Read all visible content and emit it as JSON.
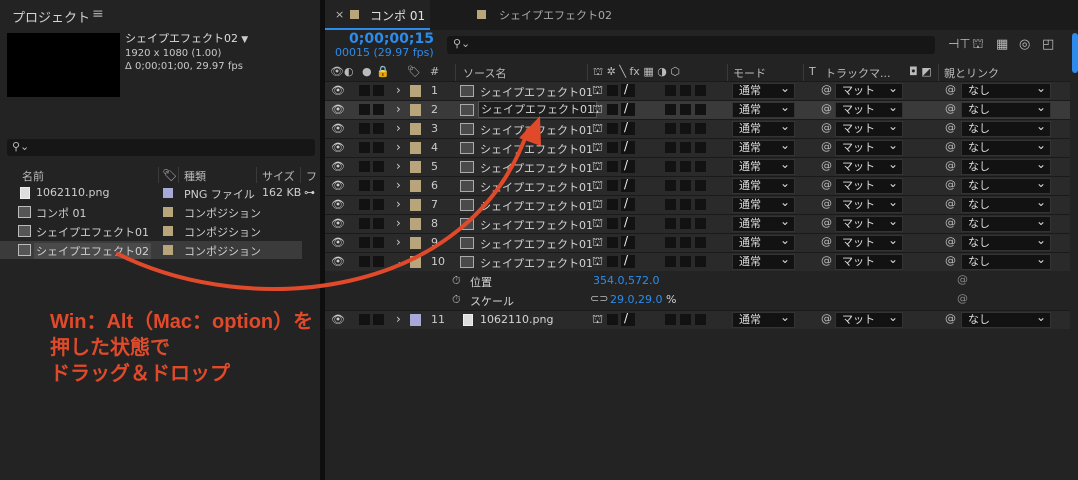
{
  "project": {
    "title": "プロジェクト",
    "menu_icon": "≡",
    "selected_name": "シェイプエフェクト02",
    "selected_dims": "1920 x 1080 (1.00)",
    "selected_duration": "Δ 0;00;01;00, 29.97 fps",
    "search_icon": "search-icon",
    "columns": {
      "name": "名前",
      "type": "種類",
      "size": "サイズ",
      "extra": "フ"
    },
    "items": [
      {
        "name": "1062110.png",
        "type": "PNG ファイル",
        "size": "162 KB",
        "label_color": "#a7aad6",
        "icon": "file-icon"
      },
      {
        "name": "コンポ 01",
        "type": "コンポジション",
        "size": "",
        "label_color": "#b9a57c",
        "icon": "composition-icon"
      },
      {
        "name": "シェイプエフェクト01",
        "type": "コンポジション",
        "size": "",
        "label_color": "#b9a57c",
        "icon": "composition-icon"
      },
      {
        "name": "シェイプエフェクト02",
        "type": "コンポジション",
        "size": "",
        "label_color": "#b9a57c",
        "icon": "composition-icon"
      }
    ]
  },
  "timeline": {
    "tabs": [
      {
        "label": "コンポ 01",
        "active": true
      },
      {
        "label": "シェイプエフェクト02",
        "active": false
      }
    ],
    "timecode": "0;00;00;15",
    "frames": "00015 (29.97 fps)",
    "columns": {
      "num": "#",
      "source": "ソース名",
      "mode": "モード",
      "t": "T",
      "track": "トラックマ...",
      "parent": "親とリンク"
    },
    "layers": [
      {
        "num": "1",
        "name": "シェイプエフェクト01",
        "mode": "通常",
        "track": "マット",
        "parent": "なし",
        "label_color": "#b9a57c"
      },
      {
        "num": "2",
        "name": "シェイプエフェクト01",
        "mode": "通常",
        "track": "マット",
        "parent": "なし",
        "label_color": "#b9a57c"
      },
      {
        "num": "3",
        "name": "シェイプエフェクト01",
        "mode": "通常",
        "track": "マット",
        "parent": "なし",
        "label_color": "#b9a57c"
      },
      {
        "num": "4",
        "name": "シェイプエフェクト01",
        "mode": "通常",
        "track": "マット",
        "parent": "なし",
        "label_color": "#b9a57c"
      },
      {
        "num": "5",
        "name": "シェイプエフェクト01",
        "mode": "通常",
        "track": "マット",
        "parent": "なし",
        "label_color": "#b9a57c"
      },
      {
        "num": "6",
        "name": "シェイプエフェクト01",
        "mode": "通常",
        "track": "マット",
        "parent": "なし",
        "label_color": "#b9a57c"
      },
      {
        "num": "7",
        "name": "シェイプエフェクト01",
        "mode": "通常",
        "track": "マット",
        "parent": "なし",
        "label_color": "#b9a57c"
      },
      {
        "num": "8",
        "name": "シェイプエフェクト01",
        "mode": "通常",
        "track": "マット",
        "parent": "なし",
        "label_color": "#b9a57c"
      },
      {
        "num": "9",
        "name": "シェイプエフェクト01",
        "mode": "通常",
        "track": "マット",
        "parent": "なし",
        "label_color": "#b9a57c"
      },
      {
        "num": "10",
        "name": "シェイプエフェクト01",
        "mode": "通常",
        "track": "マット",
        "parent": "なし",
        "label_color": "#b9a57c"
      },
      {
        "num": "11",
        "name": "1062110.png",
        "mode": "通常",
        "track": "マット",
        "parent": "なし",
        "label_color": "#a7aad6"
      }
    ],
    "properties": [
      {
        "name": "位置",
        "value": "354.0,572.0"
      },
      {
        "name": "スケール",
        "value": "29.0,29.0",
        "unit": "%"
      }
    ]
  },
  "annotation": {
    "line1": "Win：Alt（Mac：option）を",
    "line2": "押した状態で",
    "line3": "ドラッグ＆ドロップ",
    "color": "#e04a2a"
  }
}
